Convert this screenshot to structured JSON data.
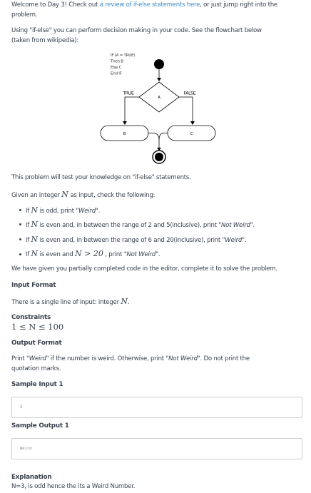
{
  "intro": {
    "line1_prefix": "Welcome to Day 3! Check out ",
    "line1_link": "a review of if-else statements here",
    "line1_suffix": ", or just jump right into the",
    "line2": "problem."
  },
  "using": {
    "line1": "Using \"if-else\" you can perform decision making in your code. See the flowchart below",
    "line2": "(taken from wikipedia):"
  },
  "flowchart": {
    "code_lines": [
      "IF (A = TRUE)",
      "Then B",
      "Else C",
      "End IF"
    ],
    "decision": "A",
    "true_label": "TRUE",
    "false_label": "FALSE",
    "box_b": "B",
    "box_c": "C"
  },
  "statement": {
    "test": "This problem will test your knowledge on \"if-else\" statements.",
    "given_prefix": "Given an integer ",
    "var": "N",
    "given_suffix": " as input, check the following:",
    "bullets": [
      {
        "a": "If ",
        "b": "N",
        "c": " is odd, print ",
        "d": "\"Weird\"",
        "e": "."
      },
      {
        "a": "If ",
        "b": "N",
        "c": " is even and, in between the range of 2 and 5(inclusive), print ",
        "d": "\"Not Weird\"",
        "e": "."
      },
      {
        "a": "If ",
        "b": "N",
        "c": " is even and, in between the range of 6 and 20(inclusive), print ",
        "d": "\"Weird\"",
        "e": "."
      },
      {
        "a": "If ",
        "b": "N",
        "c": " is even and ",
        "m": "N > 20",
        "c2": " , print ",
        "d": "\"Not Weird\"",
        "e": "."
      }
    ],
    "partial": "We have given you partially completed code in the editor, complete it to solve the problem."
  },
  "input_format": {
    "heading": "Input Format",
    "text_prefix": "There is a single line of input: integer ",
    "text_var": "N",
    "text_suffix": "."
  },
  "constraints": {
    "heading": "Constraints",
    "math": "1 ≤ N ≤ 100"
  },
  "output_format": {
    "heading": "Output Format",
    "line1_prefix": "Print ",
    "line1_weird": "\"Weird\"",
    "line1_mid": " if the number is weird. Otherwise, print ",
    "line1_notweird": "\"Not Weird\"",
    "line1_suffix": ". Do not print the",
    "line2": "quotation marks."
  },
  "sample_input": {
    "heading": "Sample Input 1",
    "value": "3"
  },
  "sample_output": {
    "heading": "Sample Output 1",
    "value": "Weird"
  },
  "explanation": {
    "heading": "Explanation",
    "text": "N=3, is odd hence the its a Weird Number."
  }
}
